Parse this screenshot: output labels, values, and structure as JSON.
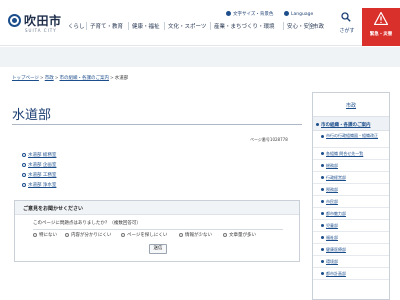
{
  "header": {
    "logo": {
      "name": "吹田市",
      "roman": "SUITA CITY"
    },
    "utility": {
      "language_label": "文字サイズ・背景色",
      "language_link": "Language"
    },
    "nav": [
      "くらし",
      "子育て・教育",
      "健康・福祉",
      "文化・スポーツ",
      "産業・まちづくり・環境",
      "安心・安全",
      "市政"
    ],
    "search_label": "さがす",
    "emergency_label": "緊急・災害"
  },
  "breadcrumb": {
    "items": [
      "トップページ",
      "市政",
      "市の組織・各課のご案内"
    ],
    "current": "水道部"
  },
  "main": {
    "title": "水道部",
    "page_id": "ページ番号1028778",
    "departments": [
      "水道部 総務室",
      "水道部 企画室",
      "水道部 工務室",
      "水道部 浄水室"
    ]
  },
  "feedback": {
    "title": "ご意見をお聞かせください",
    "question": "このページに問題点はありましたか？（複数回答可）",
    "options": [
      "特にない",
      "内容が分かりにくい",
      "ページを探しにくい",
      "情報が少ない",
      "文章量が多い"
    ],
    "submit_label": "送信"
  },
  "sidebar": {
    "heading": "市政",
    "subheading": "市の組織・各課のご案内",
    "items": [
      "市行の行政組織図・組織改正",
      "各組織 問合せ先一覧",
      "総務部",
      "行政経営部",
      "税務部",
      "市民部",
      "都市魅力部",
      "児童部",
      "福祉部",
      "健康医療部",
      "環境部",
      "都市計画部"
    ]
  }
}
